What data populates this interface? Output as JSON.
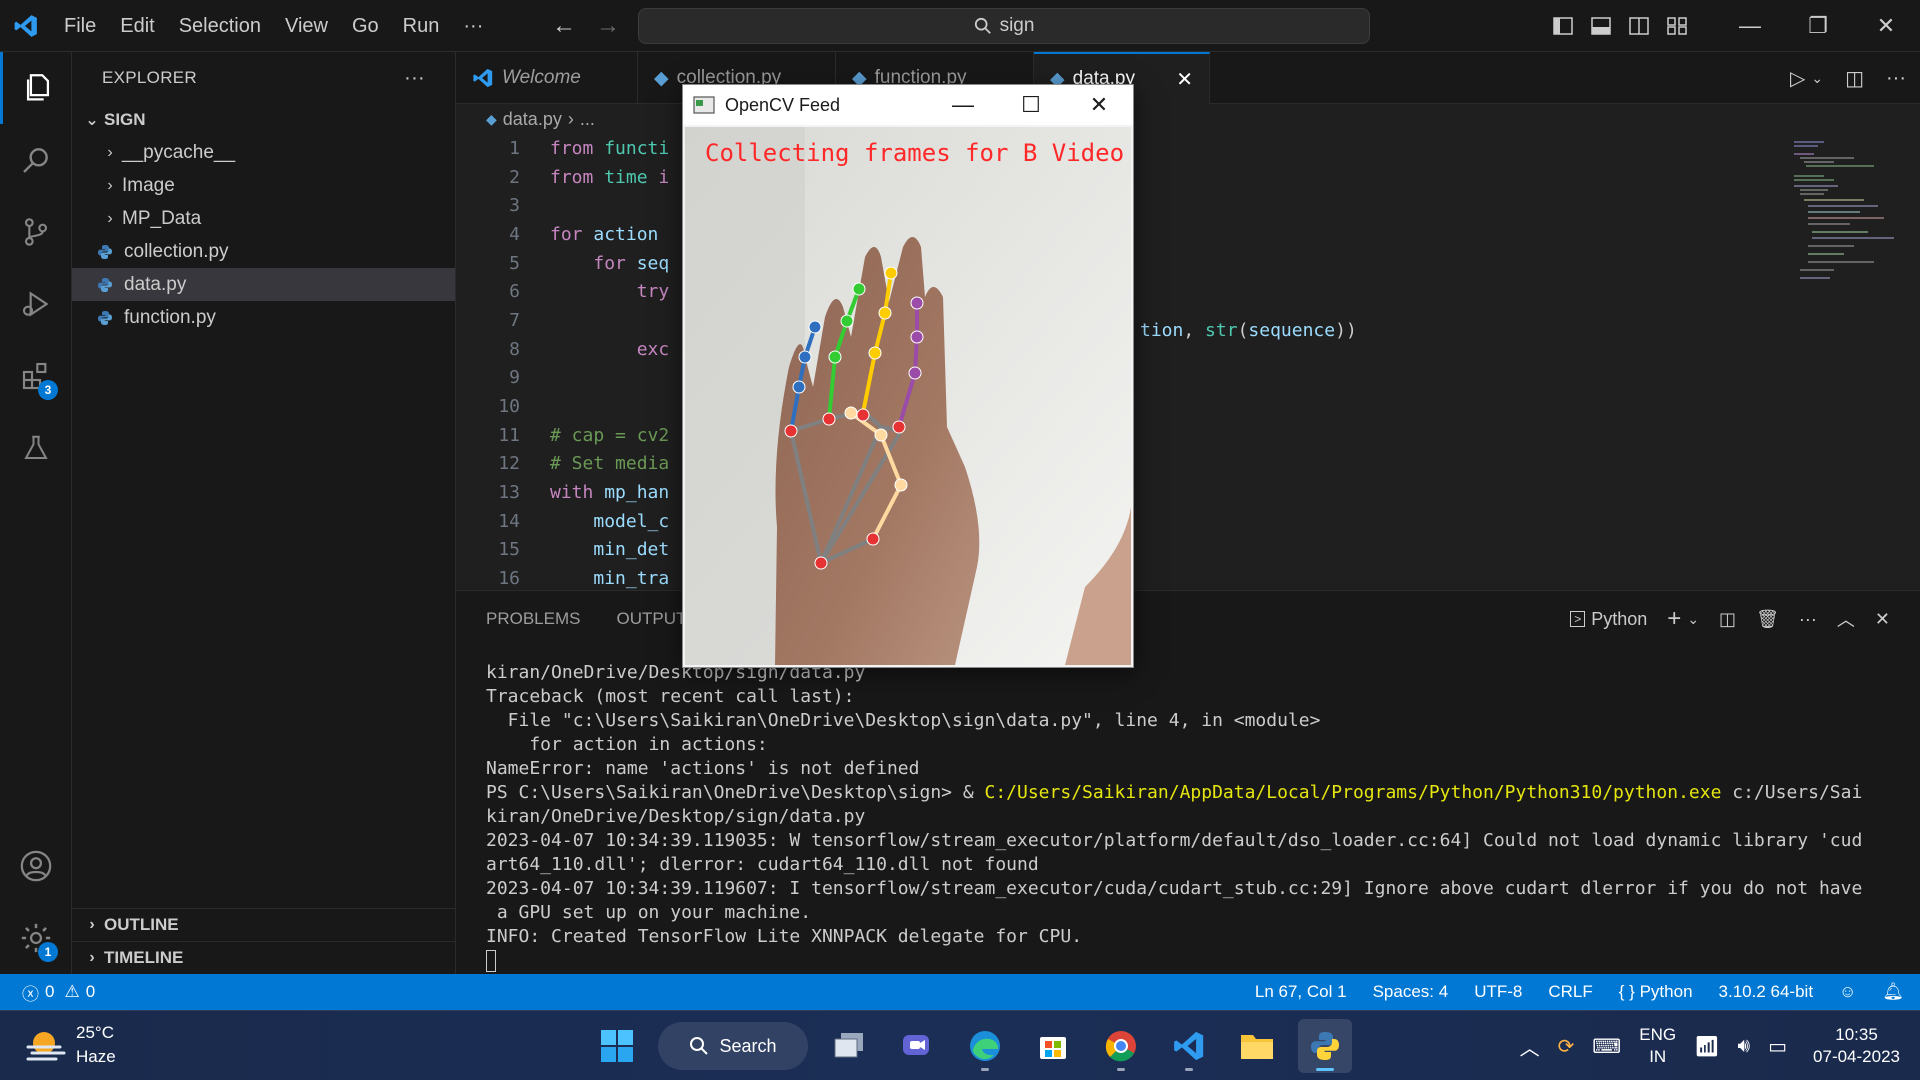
{
  "titlebar": {
    "menu": [
      "File",
      "Edit",
      "Selection",
      "View",
      "Go",
      "Run",
      "···"
    ],
    "search_text": "sign"
  },
  "activity": {
    "extensions_badge": "3",
    "settings_badge": "1"
  },
  "sidebar": {
    "title": "EXPLORER",
    "more": "···",
    "folder": "SIGN",
    "items": [
      {
        "label": "__pycache__",
        "type": "folder"
      },
      {
        "label": "Image",
        "type": "folder"
      },
      {
        "label": "MP_Data",
        "type": "folder"
      },
      {
        "label": "collection.py",
        "type": "file"
      },
      {
        "label": "data.py",
        "type": "file",
        "selected": true
      },
      {
        "label": "function.py",
        "type": "file"
      }
    ],
    "outline": "OUTLINE",
    "timeline": "TIMELINE"
  },
  "editor": {
    "tabs": [
      "Welcome",
      "collection.py",
      "function.py",
      "data.py"
    ],
    "breadcrumb_file": "data.py",
    "breadcrumb_rest": "...",
    "line_numbers": [
      "1",
      "2",
      "3",
      "4",
      "5",
      "6",
      "7",
      "8",
      "9",
      "10",
      "11",
      "12",
      "13",
      "14",
      "15",
      "16"
    ],
    "visible_right_code": "tion, str(sequence))"
  },
  "panel": {
    "tabs": [
      "PROBLEMS",
      "OUTPUT"
    ],
    "terminal_profile": "Python",
    "terminal_lines": [
      "kiran/OneDrive/Desktop/sign/data.py",
      "Traceback (most recent call last):",
      "  File \"c:\\Users\\Saikiran\\OneDrive\\Desktop\\sign\\data.py\", line 4, in <module>",
      "    for action in actions:",
      "NameError: name 'actions' is not defined",
      "PS C:\\Users\\Saikiran\\OneDrive\\Desktop\\sign> & ",
      "kiran/OneDrive/Desktop/sign/data.py",
      "2023-04-07 10:34:39.119035: W tensorflow/stream_executor/platform/default/dso_loader.cc:64] Could not load dynamic library 'cud",
      "art64_110.dll'; dlerror: cudart64_110.dll not found",
      "2023-04-07 10:34:39.119607: I tensorflow/stream_executor/cuda/cudart_stub.cc:29] Ignore above cudart dlerror if you do not have",
      " a GPU set up on your machine.",
      "INFO: Created TensorFlow Lite XNNPACK delegate for CPU."
    ],
    "ps_python_path": "C:/Users/Saikiran/AppData/Local/Programs/Python/Python310/python.exe",
    "ps_tail": " c:/Users/Sai"
  },
  "statusbar": {
    "errors": "0",
    "warnings": "0",
    "position": "Ln 67, Col 1",
    "spaces": "Spaces: 4",
    "encoding": "UTF-8",
    "eol": "CRLF",
    "language": "Python",
    "interpreter": "3.10.2 64-bit"
  },
  "opencv": {
    "title": "OpenCV Feed",
    "overlay_text": "Collecting frames for B Video Numb"
  },
  "taskbar": {
    "temperature": "25°C",
    "weather": "Haze",
    "search": "Search",
    "lang_top": "ENG",
    "lang_bottom": "IN",
    "time": "10:35",
    "date": "07-04-2023"
  },
  "colors": {
    "accent": "#0078d4",
    "statusbar": "#0078d4",
    "overlay_text": "#ff2828"
  }
}
